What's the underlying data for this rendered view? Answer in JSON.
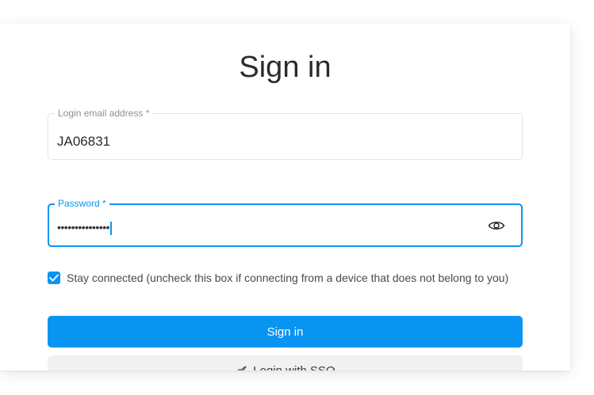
{
  "title": "Sign in",
  "email": {
    "label": "Login email address *",
    "value": "JA06831"
  },
  "password": {
    "label": "Password *",
    "masked_value": "•••••••••••••••",
    "toggle_icon": "eye-icon"
  },
  "stay_connected": {
    "checked": true,
    "label": "Stay connected (uncheck this box if connecting from a device that does not belong to you)"
  },
  "buttons": {
    "sign_in": "Sign in",
    "sso": "Login with SSO",
    "sso_icon": "rocket-icon"
  },
  "colors": {
    "accent": "#0a94f2",
    "secondary_button": "#f1f1f1"
  }
}
